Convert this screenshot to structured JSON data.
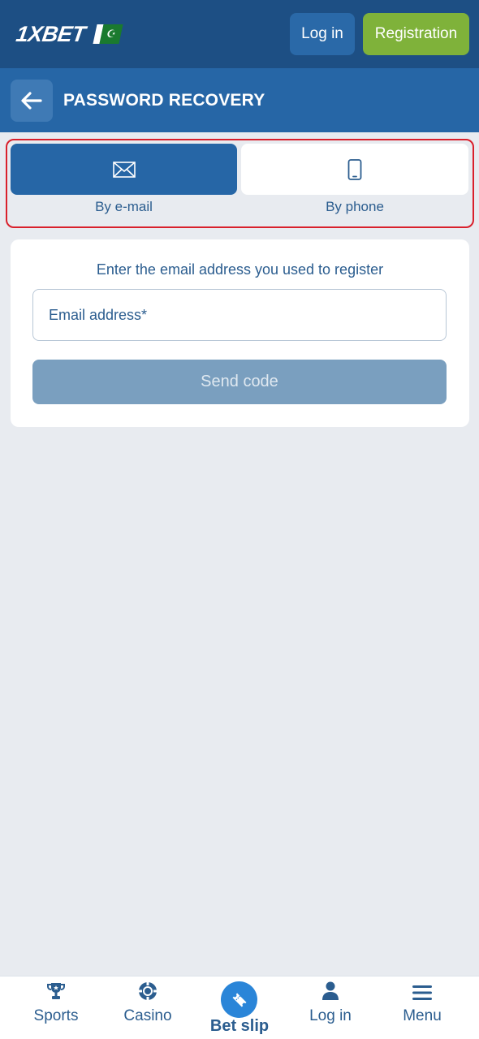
{
  "header": {
    "logo_text": "1XBET",
    "flag_symbol": "☪",
    "login_label": "Log in",
    "register_label": "Registration"
  },
  "titlebar": {
    "title": "PASSWORD RECOVERY"
  },
  "tabs": [
    {
      "label": "By e-mail",
      "icon": "envelope-icon",
      "active": true
    },
    {
      "label": "By phone",
      "icon": "smartphone-icon",
      "active": false
    }
  ],
  "form": {
    "instruction": "Enter the email address you used to register",
    "email_placeholder": "Email address*",
    "send_label": "Send code"
  },
  "bottom_nav": {
    "sports": "Sports",
    "casino": "Casino",
    "betslip": "Bet slip",
    "login": "Log in",
    "menu": "Menu"
  },
  "colors": {
    "header_bg": "#1d4f84",
    "titlebar_bg": "#2666a6",
    "registration_green": "#7fb23a",
    "highlight_red": "#d9202c",
    "page_bg": "#e8ebf0"
  }
}
